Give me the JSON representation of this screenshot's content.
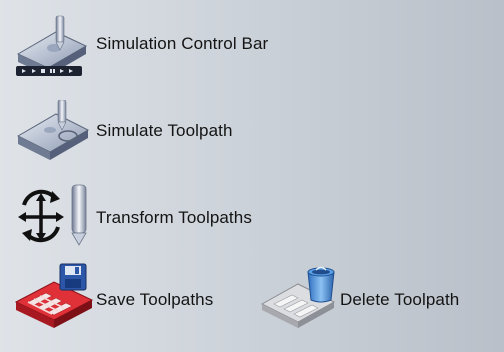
{
  "tools": {
    "simulation_control_bar": {
      "label": "Simulation Control Bar",
      "icon": "simulation-control-bar-icon"
    },
    "simulate_toolpath": {
      "label": "Simulate Toolpath",
      "icon": "simulate-toolpath-icon"
    },
    "transform_toolpaths": {
      "label": "Transform Toolpaths",
      "icon": "transform-toolpaths-icon"
    },
    "save_toolpaths": {
      "label": "Save Toolpaths",
      "icon": "save-toolpaths-icon"
    },
    "delete_toolpath": {
      "label": "Delete Toolpath",
      "icon": "delete-toolpath-icon"
    }
  },
  "colors": {
    "background_light": "#dfe3e8",
    "background_dark": "#b9c0c9",
    "label_text": "#141414",
    "save_accent": "#d8202a",
    "disk_blue": "#2c56a8",
    "bin_blue": "#4a8fd8"
  }
}
